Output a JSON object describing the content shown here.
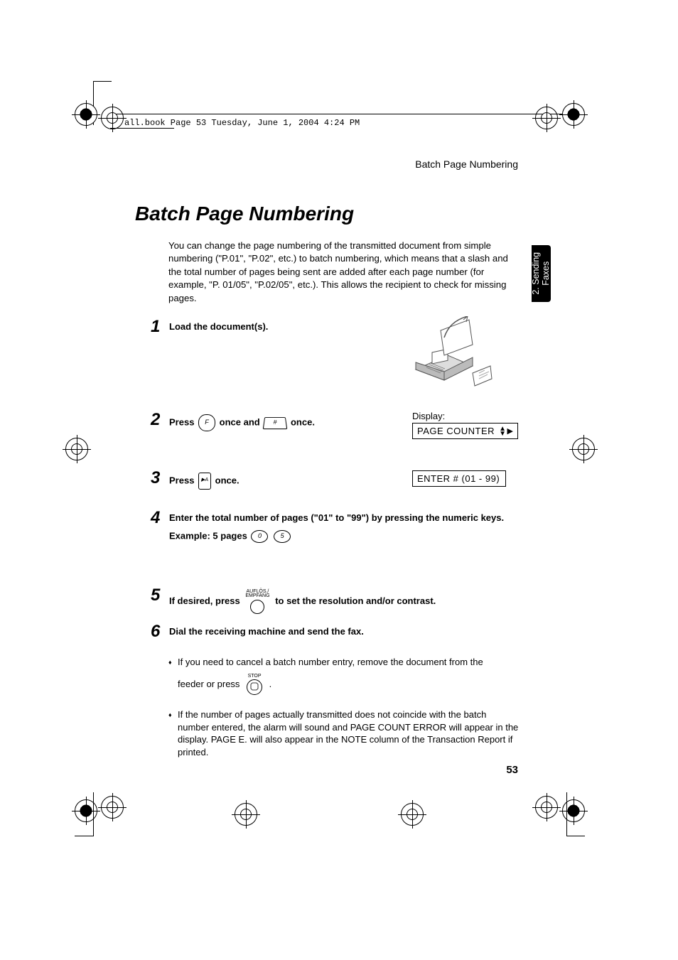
{
  "meta": {
    "book_line": "all.book  Page 53  Tuesday, June 1, 2004  4:24 PM"
  },
  "header": {
    "running": "Batch Page Numbering"
  },
  "section": {
    "title": "Batch Page Numbering",
    "intro": "You can change the page numbering of the transmitted document from simple numbering (\"P.01\", \"P.02\", etc.) to batch numbering, which means that a slash and the total number of pages being sent are added after each page number (for example, \"P. 01/05\", \"P.02/05\", etc.). This allows the recipient to check for missing pages."
  },
  "side_tab": {
    "line1": "2. Sending",
    "line2": "Faxes"
  },
  "steps": {
    "s1": {
      "num": "1",
      "text": "Load the document(s)."
    },
    "s2": {
      "num": "2",
      "prefix": "Press ",
      "key1": "F",
      "mid": " once and ",
      "key2": "#",
      "suffix": " once.",
      "display_label": "Display:",
      "lcd": "PAGE COUNTER"
    },
    "s3": {
      "num": "3",
      "prefix": "Press ",
      "key1": "▶|A",
      "suffix": " once.",
      "lcd": "ENTER # (01 - 99)"
    },
    "s4": {
      "num": "4",
      "text": "Enter the total number of pages (\"01\" to \"99\") by pressing the numeric keys.",
      "example_label": "Example: 5 pages",
      "example_key1": "0",
      "example_key2": "5"
    },
    "s5": {
      "num": "5",
      "prefix": "If desired, press ",
      "key_label_top1": "AUFLÖS./",
      "key_label_top2": "EMPFANG",
      "suffix": " to set the resolution and/or contrast."
    },
    "s6": {
      "num": "6",
      "text": "Dial the receiving machine and send the fax."
    }
  },
  "notes": {
    "n1_a": "If you need to cancel a batch number entry, remove the document from the ",
    "n1_b": "feeder or press ",
    "n1_key_label": "STOP",
    "n1_c": ".",
    "n2": "If the number of pages actually transmitted does not coincide with the batch number entered, the alarm will sound and PAGE COUNT ERROR will appear in the display. PAGE E. will also appear in the NOTE column of the Transaction Report if printed."
  },
  "footer": {
    "page": "53"
  }
}
